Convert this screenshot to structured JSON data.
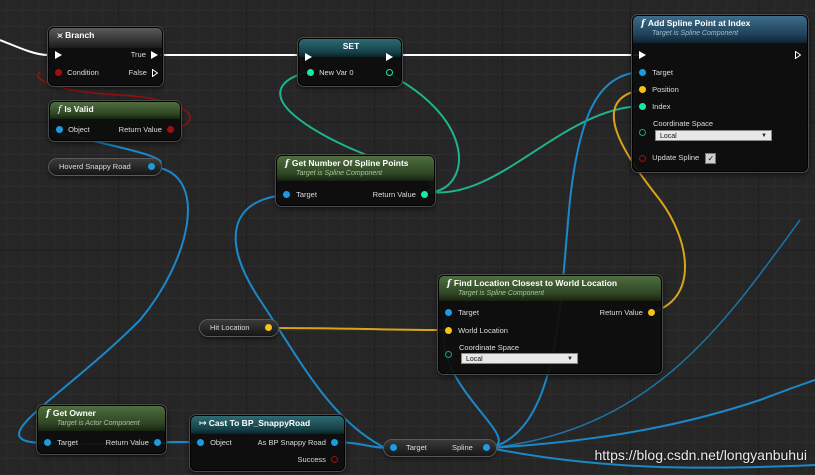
{
  "colors": {
    "exec": "#ffffff",
    "object_pin": "#1e9be0",
    "vector_pin": "#f5c21a",
    "int_pin": "#1ee6a8",
    "bool_pin": "#a01010",
    "wire_blue": "#1b88c9",
    "wire_yellow": "#d9a41a",
    "wire_teal": "#1fb38e"
  },
  "branch": {
    "title": "Branch",
    "icon": "branch-icon",
    "condition": "Condition",
    "true_label": "True",
    "false_label": "False"
  },
  "set_node": {
    "title": "SET",
    "new_var": "New Var 0"
  },
  "add_spline_point": {
    "title": "Add Spline Point at Index",
    "subtitle": "Target is Spline Component",
    "target": "Target",
    "position": "Position",
    "index": "Index",
    "coordinate_space": "Coordinate Space",
    "coordinate_value": "Local",
    "update_spline": "Update Spline",
    "update_checked": true
  },
  "is_valid": {
    "title": "Is Valid",
    "object": "Object",
    "return_value": "Return Value"
  },
  "hoverd_var": {
    "label": "Hoverd Snappy Road"
  },
  "get_num_points": {
    "title": "Get Number Of Spline Points",
    "subtitle": "Target is Spline Component",
    "target": "Target",
    "return_value": "Return Value"
  },
  "find_location": {
    "title": "Find Location Closest to World Location",
    "subtitle": "Target is Spline Component",
    "target": "Target",
    "world_location": "World Location",
    "coordinate_space": "Coordinate Space",
    "coordinate_value": "Local",
    "return_value": "Return Value"
  },
  "hit_location": {
    "label": "Hit Location"
  },
  "get_owner": {
    "title": "Get Owner",
    "subtitle": "Target is Actor Component",
    "target": "Target",
    "return_value": "Return Value"
  },
  "cast_node": {
    "title": "Cast To BP_SnappyRoad",
    "object": "Object",
    "as_label": "As BP Snappy Road",
    "success": "Success"
  },
  "spline_getter": {
    "target": "Target",
    "spline": "Spline"
  },
  "watermark": "https://blog.csdn.net/longyanbuhui"
}
